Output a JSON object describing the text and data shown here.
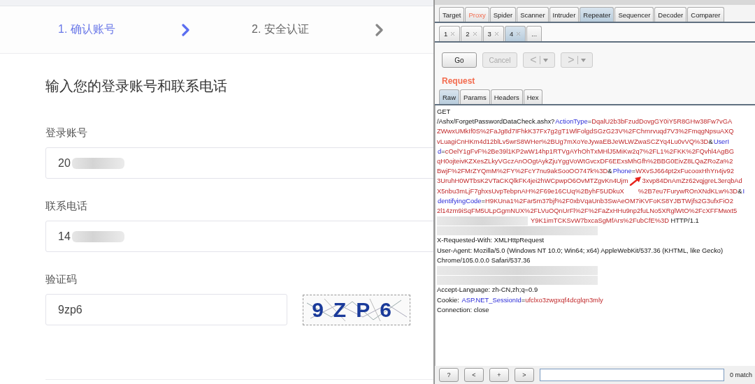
{
  "page": {
    "steps": [
      {
        "label": "1. 确认账号",
        "selected": true
      },
      {
        "label": "2. 安全认证",
        "selected": false
      }
    ],
    "heading": "输入您的登录账号和联系电话",
    "fields": [
      {
        "kind": "text",
        "label": "登录账号",
        "value": "20",
        "redacted": true
      },
      {
        "kind": "text",
        "label": "联系电话",
        "value": "14",
        "redacted": true
      },
      {
        "kind": "captcha",
        "label": "验证码",
        "value": "9zp6",
        "captcha": "9ZP6",
        "redacted": false
      }
    ]
  },
  "burp": {
    "tabs": [
      {
        "label": "Target",
        "selected": false,
        "highlighted": false
      },
      {
        "label": "Proxy",
        "selected": false,
        "highlighted": true
      },
      {
        "label": "Spider",
        "selected": false,
        "highlighted": false
      },
      {
        "label": "Scanner",
        "selected": false,
        "highlighted": false
      },
      {
        "label": "Intruder",
        "selected": false,
        "highlighted": false
      },
      {
        "label": "Repeater",
        "selected": true,
        "highlighted": false
      },
      {
        "label": "Sequencer",
        "selected": false,
        "highlighted": false
      },
      {
        "label": "Decoder",
        "selected": false,
        "highlighted": false
      },
      {
        "label": "Comparer",
        "selected": false,
        "highlighted": false
      }
    ],
    "repeater_tabs": [
      {
        "label": "1",
        "selected": false,
        "closable": true
      },
      {
        "label": "2",
        "selected": false,
        "closable": true
      },
      {
        "label": "3",
        "selected": false,
        "closable": true
      },
      {
        "label": "4",
        "selected": true,
        "closable": true
      },
      {
        "label": "...",
        "selected": false,
        "closable": false
      }
    ],
    "toolbar": [
      {
        "label": "Go",
        "disabled": false,
        "menu": false
      },
      {
        "label": "Cancel",
        "disabled": true,
        "menu": false
      },
      {
        "label": "<",
        "disabled": true,
        "menu": true
      },
      {
        "label": ">",
        "disabled": true,
        "menu": true
      }
    ],
    "request_title": "Request",
    "view_tabs": [
      {
        "label": "Raw",
        "selected": true
      },
      {
        "label": "Params",
        "selected": false
      },
      {
        "label": "Headers",
        "selected": false
      },
      {
        "label": "Hex",
        "selected": false
      }
    ],
    "request_lines": [
      {
        "kind": "text",
        "segments": [
          {
            "kind": "plain",
            "text": "GET"
          }
        ]
      },
      {
        "kind": "text",
        "segments": [
          {
            "kind": "plain",
            "text": "/Ashx/ForgetPasswordDataCheck.ashx?"
          },
          {
            "kind": "param",
            "text": "ActionType"
          },
          {
            "kind": "plain",
            "text": "="
          },
          {
            "kind": "value",
            "text": "DqalU2b3bFzudDovgGY0iY5R8GHw38Fw7vGA"
          }
        ]
      },
      {
        "kind": "text",
        "segments": [
          {
            "kind": "value",
            "text": "ZWwxUMkIf0S%2FaJg8d7IFhkK37Fx7g2gT1WlFolgdSGzG23V%2FChrnrvuqd7V3%2FmqgNpsuAXQ"
          }
        ]
      },
      {
        "kind": "text",
        "segments": [
          {
            "kind": "value",
            "text": "vLuagiCnHKm4d12blLv5wrS8WHer%2BUg7mXoYeJywaEBJeWLWZwaSCZYq4Lu0vVQ%3D"
          },
          {
            "kind": "plain",
            "text": "&"
          },
          {
            "kind": "param",
            "text": "UserI"
          }
        ]
      },
      {
        "kind": "text",
        "segments": [
          {
            "kind": "param",
            "text": "d"
          },
          {
            "kind": "plain",
            "text": "="
          },
          {
            "kind": "value",
            "text": "cOelY1gFvF%2Be39l1KP2wW14hp1RTVgAYhOhTxMHlJ5MiKw2q7%2FL1%2FKK%2FQvhl4AgBG"
          }
        ]
      },
      {
        "kind": "text",
        "segments": [
          {
            "kind": "value",
            "text": "qH0ojteivKZXesZLkyVGczAnOOgtAykZjuYggVoWtGvcxDF6EExsMhGfh%2BBG0EivZ8LQaZRoZa%2"
          }
        ]
      },
      {
        "kind": "text",
        "segments": [
          {
            "kind": "value",
            "text": "BwjF%2FMrZYQmM%2FY%2FcY7nu9akSooOO747k%3D"
          },
          {
            "kind": "plain",
            "text": "&"
          },
          {
            "kind": "param",
            "text": "Phone"
          },
          {
            "kind": "plain",
            "text": "="
          },
          {
            "kind": "value",
            "text": "WXvSJ664pt2xFucooxHhYn4jv92"
          }
        ]
      },
      {
        "kind": "text",
        "segments": [
          {
            "kind": "value",
            "text": "3UruhH0WTbsK2VTaCKQlkFK4jei2hWCpwpO6OvMTZgvKn4Ujm"
          },
          {
            "kind": "value",
            "text": "3xvp84DnAmZz62vqjgreL3erqbAd",
            "gap": true
          }
        ]
      },
      {
        "kind": "text",
        "segments": [
          {
            "kind": "value",
            "text": "X5nbu3mLjF7ghxsUvpTebpnAH%2F69e16CUq%2ByhF5UDkuX"
          },
          {
            "kind": "value",
            "text": "%2B7eu7FurywROnXNdKLw%3D",
            "gap": true
          },
          {
            "kind": "plain",
            "text": "&"
          },
          {
            "kind": "param",
            "text": "I"
          }
        ]
      },
      {
        "kind": "text",
        "segments": [
          {
            "kind": "param",
            "text": "dentifyingCode"
          },
          {
            "kind": "plain",
            "text": "="
          },
          {
            "kind": "value",
            "text": "H9KUna1%2Far5m37bjf%2F0xbVqaUnb3SwAeOM7iKVFoKS8YJBTWjfs2G3ufxFiO2"
          }
        ]
      },
      {
        "kind": "text",
        "segments": [
          {
            "kind": "value",
            "text": "2l14zm9iSqFM5ULpGgmNUX%2FLVuOQnUrFl%2F%2FaZxHHu9np2fuLNo5XRglWtO%2FcXFFMwxt5"
          }
        ]
      },
      {
        "kind": "text",
        "segments": [
          {
            "kind": "redacted"
          },
          {
            "kind": "value",
            "text": "Y9K1imTCKSvW7bxcaSgMfArs%2FubCfE%3D"
          },
          {
            "kind": "plain",
            "text": " HTTP/1.1"
          }
        ]
      },
      {
        "kind": "redacted"
      },
      {
        "kind": "text",
        "segments": [
          {
            "kind": "plain",
            "text": "X-Requested-With: XMLHttpRequest"
          }
        ]
      },
      {
        "kind": "text",
        "segments": [
          {
            "kind": "plain",
            "text": "User-Agent: Mozilla/5.0 (Windows NT 10.0; Win64; x64) AppleWebKit/537.36 (KHTML, like Gecko)"
          }
        ]
      },
      {
        "kind": "text",
        "segments": [
          {
            "kind": "plain",
            "text": "Chrome/105.0.0.0 Safari/537.36"
          }
        ]
      },
      {
        "kind": "redacted"
      },
      {
        "kind": "redacted"
      },
      {
        "kind": "text",
        "segments": [
          {
            "kind": "plain",
            "text": "Accept-Language: zh-CN,zh;q=0.9"
          }
        ]
      },
      {
        "kind": "text",
        "segments": [
          {
            "kind": "plain",
            "text": "Cookie: "
          },
          {
            "kind": "param",
            "text": "ASP.NET_SessionId"
          },
          {
            "kind": "plain",
            "text": "="
          },
          {
            "kind": "value",
            "text": "ufclxo3zwgxqf4dcglqn3mly"
          }
        ]
      },
      {
        "kind": "text",
        "segments": [
          {
            "kind": "plain",
            "text": "Connection: close"
          }
        ]
      }
    ],
    "search_buttons": [
      "?",
      "<",
      "+",
      ">"
    ],
    "matches": "0 match"
  },
  "annotation": {
    "kind": "arrow"
  }
}
